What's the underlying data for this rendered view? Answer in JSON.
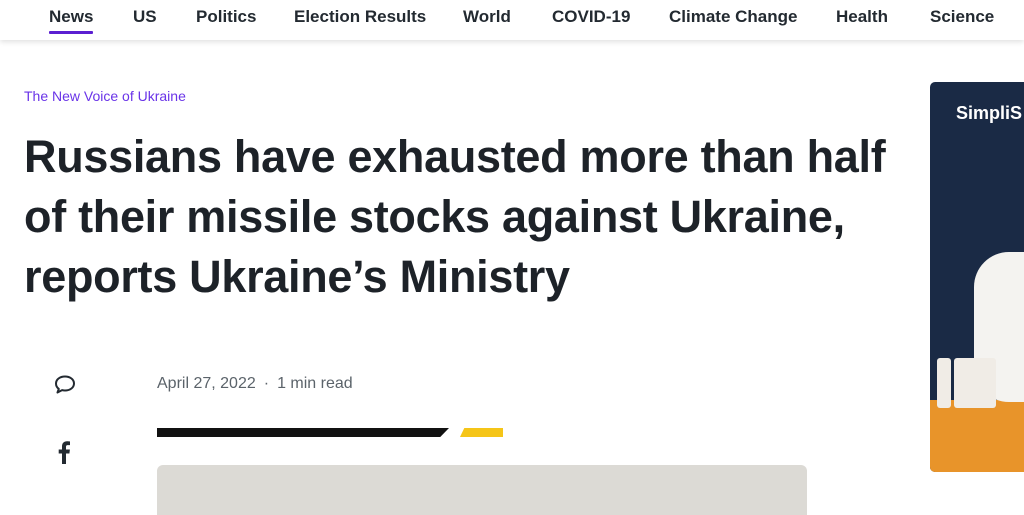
{
  "nav": {
    "items": [
      {
        "label": "News",
        "active": true
      },
      {
        "label": "US"
      },
      {
        "label": "Politics"
      },
      {
        "label": "Election Results"
      },
      {
        "label": "World"
      },
      {
        "label": "COVID-19"
      },
      {
        "label": "Climate Change"
      },
      {
        "label": "Health"
      },
      {
        "label": "Science"
      }
    ]
  },
  "article": {
    "category": "The New Voice of Ukraine",
    "headline": "Russians have exhausted more than half of their missile stocks against Ukraine, reports Ukraine’s Ministry",
    "date": "April 27, 2022",
    "separator": "·",
    "read_time": "1 min read"
  },
  "share": {
    "comment_icon": "comment-icon",
    "facebook_icon": "facebook-icon"
  },
  "ad": {
    "brand": "SimpliS"
  },
  "colors": {
    "accent": "#6a34e8",
    "nav_underline": "#5b1fd1",
    "rule_black": "#111111",
    "rule_yellow": "#f5c518"
  }
}
